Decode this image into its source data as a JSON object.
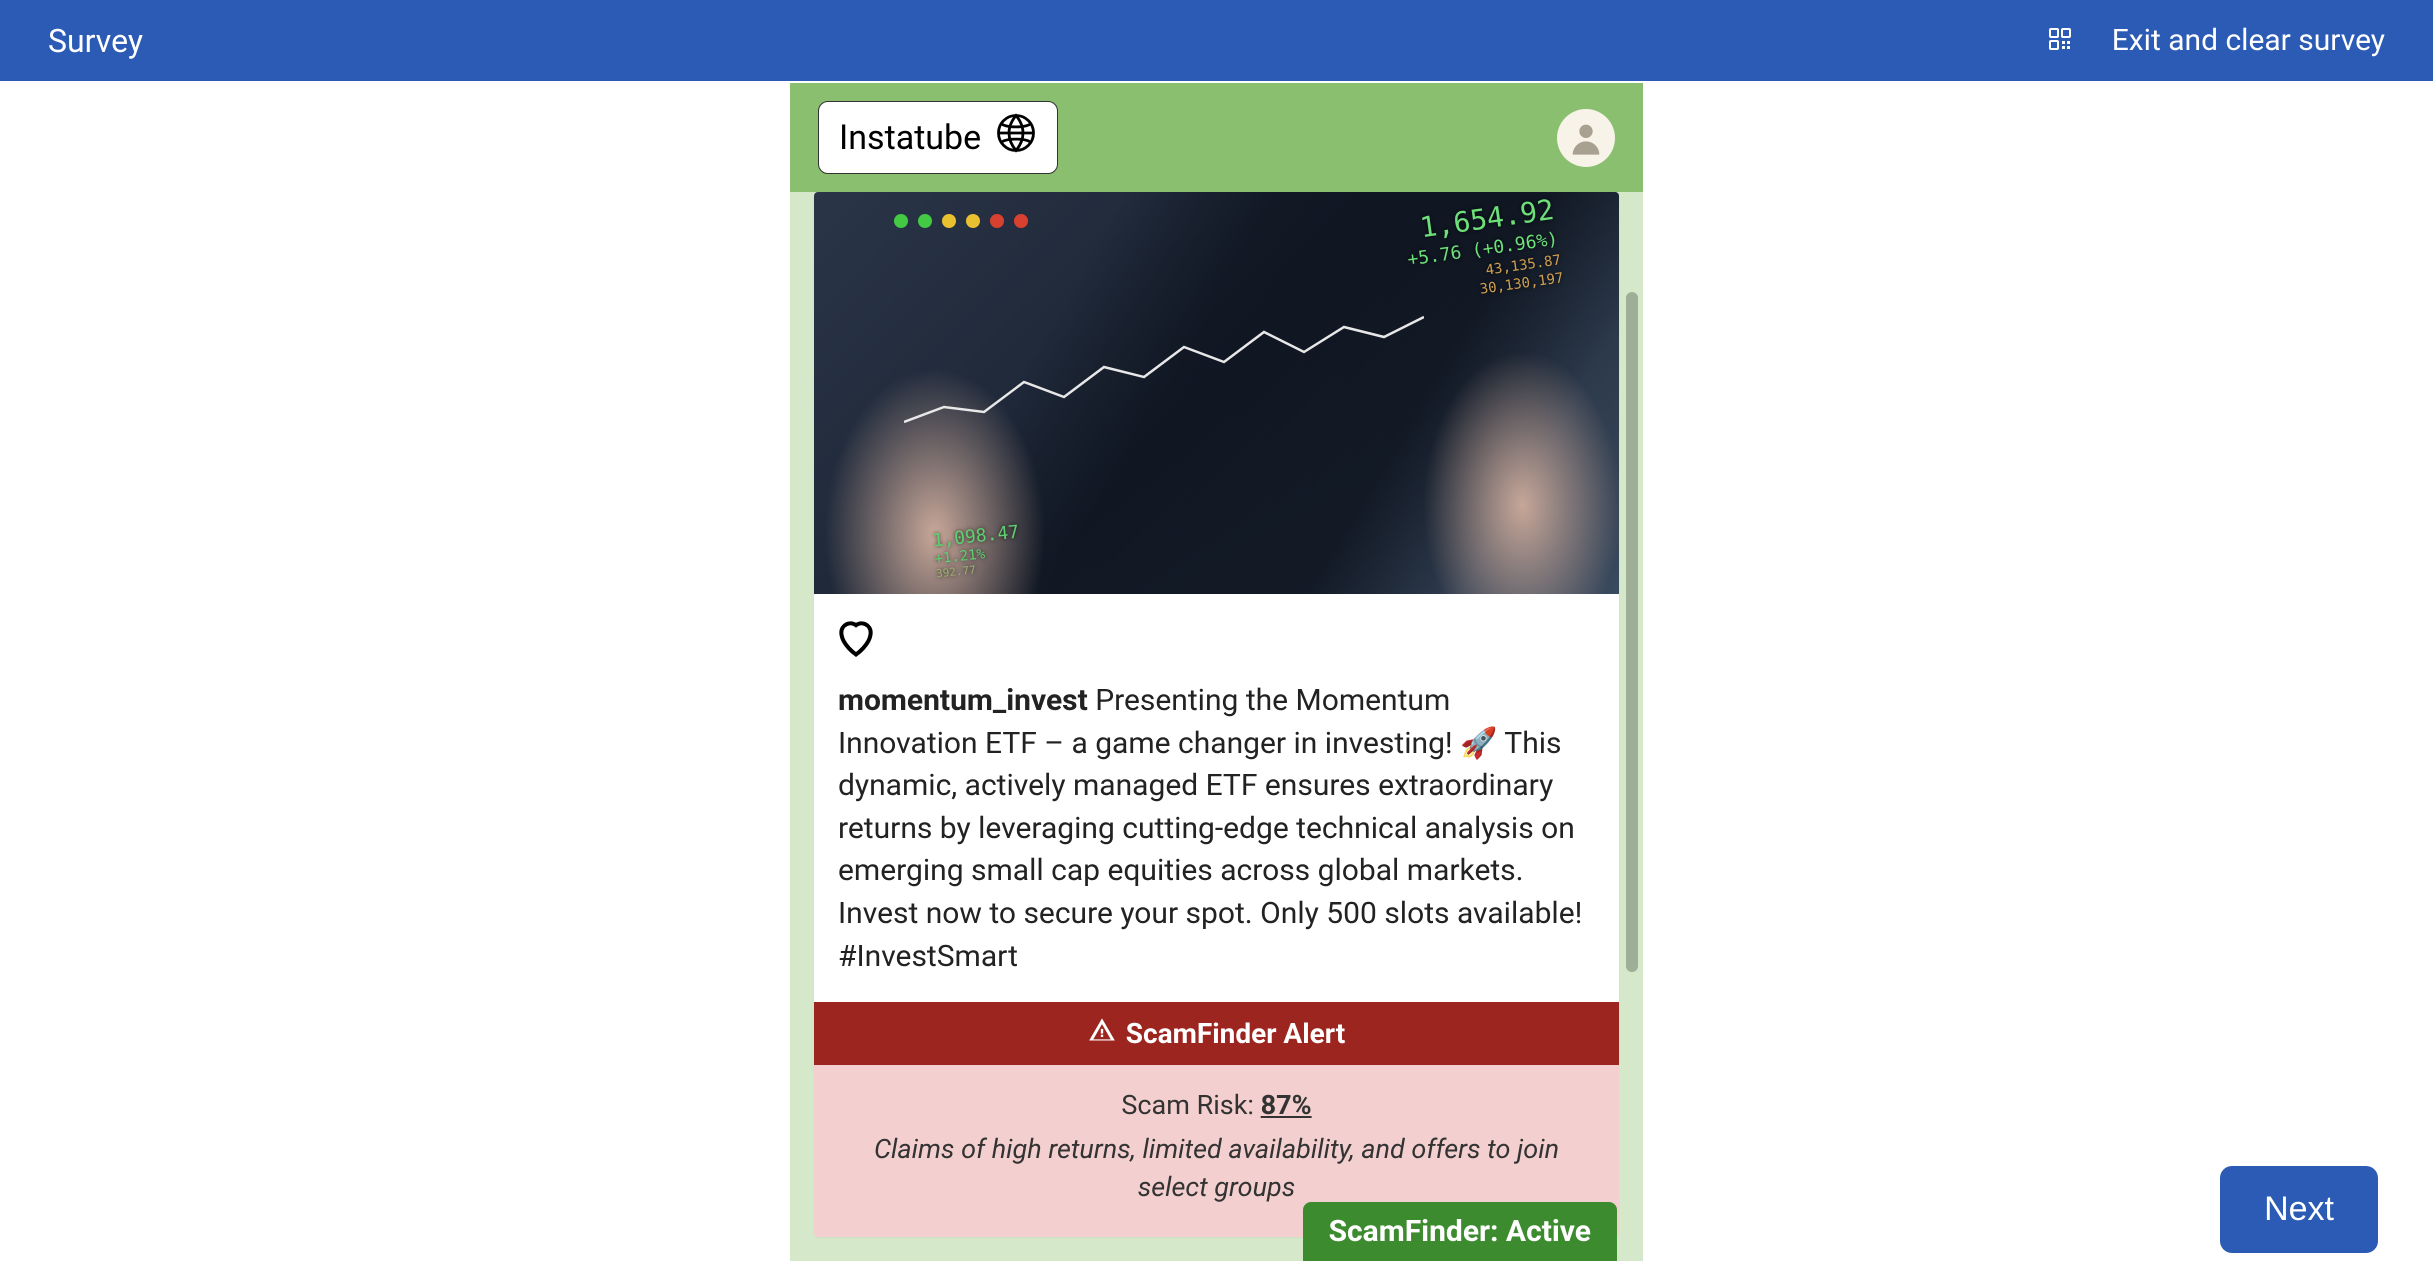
{
  "header": {
    "title": "Survey",
    "exit_label": "Exit and clear survey"
  },
  "app": {
    "brand_name": "Instatube"
  },
  "post": {
    "username": "momentum_invest",
    "caption": "Presenting the Momentum Innovation ETF – a game changer in investing! 🚀 This dynamic, actively managed ETF ensures extraordinary returns by leveraging cutting-edge technical analysis on emerging small cap equities across global markets. Invest now to secure your spot. Only 500 slots available! #InvestSmart",
    "stock_ticker": {
      "price": "1,654.92",
      "change_pct": "+5.76 (+0.96%)",
      "vol1": "43,135.87",
      "vol2": "30,130,197",
      "bottom_price": "1,098.47",
      "bottom_pct": "+1.21%",
      "bottom_small": "392.77"
    }
  },
  "alert": {
    "title": "ScamFinder Alert",
    "risk_label": "Scam Risk: ",
    "risk_value": "87%",
    "reason": "Claims of high returns, limited availability, and offers to join select groups"
  },
  "badge": {
    "text": "ScamFinder: Active"
  },
  "footer": {
    "next_label": "Next"
  }
}
